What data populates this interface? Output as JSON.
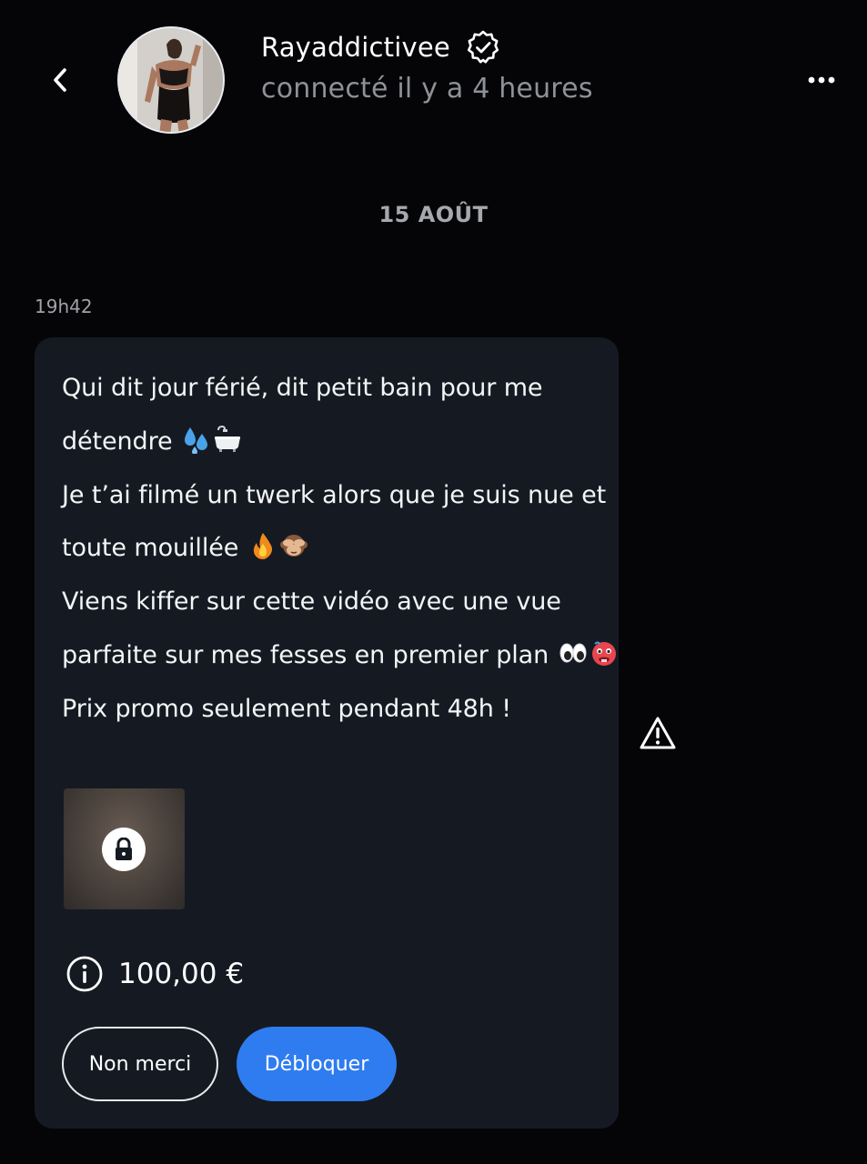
{
  "header": {
    "username": "Rayaddictivee",
    "status": "connecté il y a 4 heures",
    "back_icon": "chevron-left-icon",
    "verified_icon": "verified-badge-icon",
    "more_icon": "more-horizontal-icon"
  },
  "date_separator": "15 AOÛT",
  "message": {
    "time": "19h42",
    "lines": [
      {
        "text": "Qui dit jour férié, dit petit bain pour me",
        "emojis": []
      },
      {
        "text": "détendre",
        "emojis": [
          "sweat-droplets-emoji",
          "bathtub-emoji"
        ]
      },
      {
        "text": "Je t’ai filmé un twerk alors que je suis nue et",
        "emojis": []
      },
      {
        "text": "toute mouillée",
        "emojis": [
          "fire-emoji",
          "see-no-evil-monkey-emoji"
        ]
      },
      {
        "text": "Viens kiffer sur cette vidéo avec une vue",
        "emojis": []
      },
      {
        "text": "parfaite sur mes fesses en premier plan",
        "emojis": [
          "eyes-emoji",
          "hot-face-emoji"
        ]
      },
      {
        "text": "Prix promo seulement pendant 48h !",
        "emojis": []
      }
    ],
    "media": {
      "locked": true,
      "lock_icon": "lock-icon"
    },
    "price": "100,00 €",
    "info_icon": "info-icon",
    "decline_label": "Non merci",
    "unlock_label": "Débloquer"
  },
  "report_icon": "warning-triangle-icon",
  "colors": {
    "background": "#050508",
    "bubble": "#151a22",
    "accent": "#2f7cf0",
    "muted_text": "#8e9197"
  }
}
